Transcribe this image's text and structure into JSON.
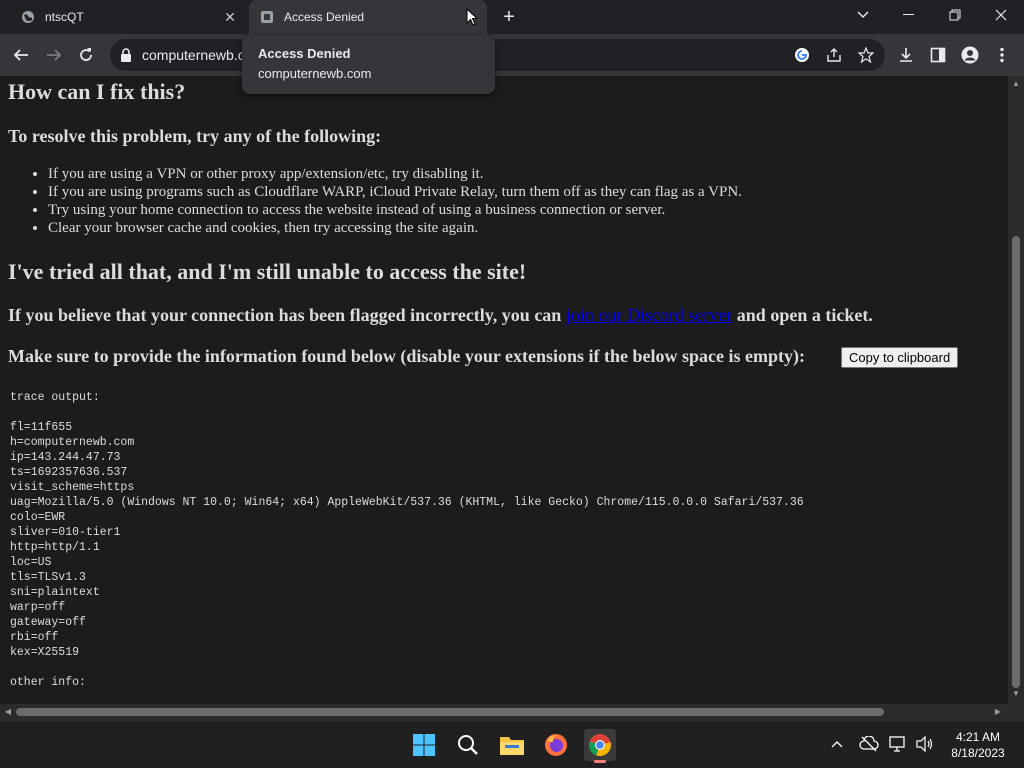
{
  "browser": {
    "tabs": [
      {
        "title": "ntscQT",
        "active": false
      },
      {
        "title": "Access Denied",
        "active": true
      }
    ],
    "address": "computernewb.c",
    "hovercard": {
      "title": "Access Denied",
      "domain": "computernewb.com"
    }
  },
  "page": {
    "heading_fix": "How can I fix this?",
    "heading_resolve": "To resolve this problem, try any of the following:",
    "tips": [
      "If you are using a VPN or other proxy app/extension/etc, try disabling it.",
      "If you are using programs such as Cloudflare WARP, iCloud Private Relay, turn them off as they can flag as a VPN.",
      "Try using your home connection to access the website instead of using a business connection or server.",
      "Clear your browser cache and cookies, then try accessing the site again."
    ],
    "heading_tried": "I've tried all that, and I'm still unable to access the site!",
    "ticket_prefix": "If you believe that your connection has been flagged incorrectly, you can",
    "ticket_link": "join our Discord server",
    "ticket_suffix": "and open a ticket.",
    "info_text": "Make sure to provide the information found below (disable your extensions if the below space is empty):",
    "copy_button": "Copy to clipboard",
    "trace_lines": [
      "trace output:",
      "",
      "fl=11f655",
      "h=computernewb.com",
      "ip=143.244.47.73",
      "ts=1692357636.537",
      "visit_scheme=https",
      "uag=Mozilla/5.0 (Windows NT 10.0; Win64; x64) AppleWebKit/537.36 (KHTML, like Gecko) Chrome/115.0.0.0 Safari/537.36",
      "colo=EWR",
      "sliver=010-tier1",
      "http=http/1.1",
      "loc=US",
      "tls=TLSv1.3",
      "sni=plaintext",
      "warp=off",
      "gateway=off",
      "rbi=off",
      "kex=X25519",
      "",
      "other info:"
    ]
  },
  "taskbar": {
    "apps": [
      "start-icon",
      "search-icon",
      "file-explorer-icon",
      "firefox-icon",
      "chrome-icon"
    ],
    "time": "4:21 AM",
    "date": "8/18/2023"
  },
  "colors": {
    "link": "#0000ee",
    "background": "#1c1c1c",
    "text": "#dcdcdc"
  }
}
